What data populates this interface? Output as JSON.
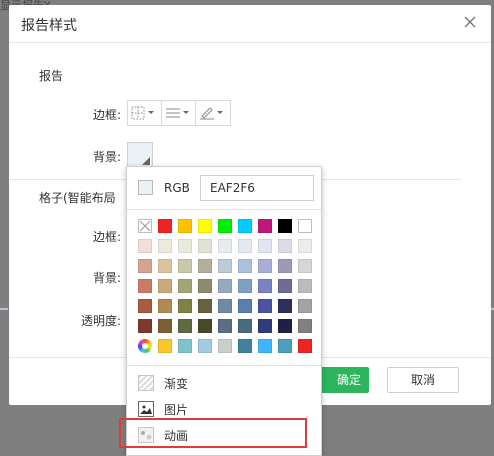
{
  "background": {
    "partial_text": "显示报告Y"
  },
  "dialog": {
    "title": "报告样式",
    "report_section": "报告",
    "border_label": "边框:",
    "background_label": "背景:",
    "grid_section": "格子(智能布局",
    "grid_border_label": "边框:",
    "grid_background_label": "背景:",
    "opacity_label": "透明度:",
    "ok_label": "确定",
    "cancel_label": "取消"
  },
  "picker": {
    "rgb_label": "RGB",
    "rgb_value": "EAF2F6",
    "current_color": "#eaf2f6",
    "palette": [
      [
        "none",
        "#f02323",
        "#ffc000",
        "#ffff00",
        "#00ee00",
        "#00cdff",
        "#c0187a",
        "#000000",
        "empty"
      ],
      [
        "#f2ddd9",
        "#eee9dd",
        "#ebeadf",
        "#e2e1d7",
        "#e8ecef",
        "#e3e9f2",
        "#e1e4f2",
        "#dcdce6",
        "#ececec"
      ],
      [
        "#d5a392",
        "#dcc39f",
        "#c8c7a6",
        "#b2b09a",
        "#bbccd7",
        "#aac0dc",
        "#a8aed8",
        "#9c9ab7",
        "#d6d6d6"
      ],
      [
        "#c87b65",
        "#cba87a",
        "#a4a574",
        "#8d8b6c",
        "#93aabf",
        "#7f9fc7",
        "#7a82c2",
        "#6e6b94",
        "#bcbcbc"
      ],
      [
        "#aa5a3f",
        "#b08955",
        "#7f8146",
        "#66633e",
        "#6f8ba4",
        "#5a7eb0",
        "#4b54a3",
        "#2f2f5e",
        "#a3a3a3"
      ],
      [
        "#7d3a2a",
        "#7d5f35",
        "#5d6a42",
        "#48492a",
        "#5d6d83",
        "#476c7f",
        "#2e3c7a",
        "#1f2046",
        "#808080"
      ],
      [
        "wheel",
        "#f7c82c",
        "#7fc2c9",
        "#a0cbe0",
        "#c9cfcb",
        "#40829c",
        "#3fb4ff",
        "#4b9ebe",
        "#f02323"
      ]
    ],
    "menu": [
      {
        "label": "渐变",
        "icon": "gradient-icon"
      },
      {
        "label": "图片",
        "icon": "image-icon"
      },
      {
        "label": "动画",
        "icon": "animation-icon"
      }
    ],
    "highlighted_item": "动画",
    "highlight_color": "#e03a3a"
  },
  "colors": {
    "ok_button": "#2db55d"
  }
}
